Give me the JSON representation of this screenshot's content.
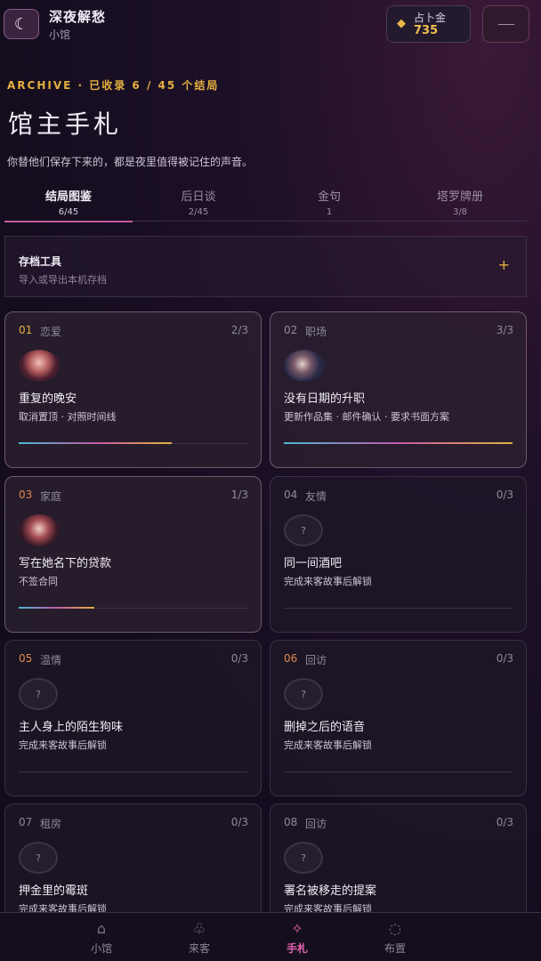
{
  "header": {
    "moon_icon": "moon-icon",
    "title": "深夜解愁",
    "subtitle": "小馆",
    "coin_label": "占卜金",
    "coin_value": "735",
    "menu_icon": "menu-icon"
  },
  "page": {
    "kicker": "ARCHIVE · 已收录 6 / 45 个结局",
    "title": "馆主手札",
    "description": "你替他们保存下来的，都是夜里值得被记住的声音。"
  },
  "tabs": [
    {
      "label": "结局图鉴",
      "count": "6/45",
      "active": true
    },
    {
      "label": "后日谈",
      "count": "2/45",
      "active": false
    },
    {
      "label": "金句",
      "count": "1",
      "active": false
    },
    {
      "label": "塔罗牌册",
      "count": "3/8",
      "active": false
    }
  ],
  "tools": {
    "title": "存档工具",
    "subtitle": "导入或导出本机存档",
    "expand_icon": "plus-icon"
  },
  "cards": [
    {
      "num": "01",
      "category": "恋爱",
      "count": "2/3",
      "title": "重复的晚安",
      "subtitle": "取消置顶 · 对照时间线",
      "unlocked": true,
      "progress": 0.67
    },
    {
      "num": "02",
      "category": "职场",
      "count": "3/3",
      "title": "没有日期的升职",
      "subtitle": "更新作品集 · 邮件确认 · 要求书面方案",
      "unlocked": true,
      "progress": 1.0
    },
    {
      "num": "03",
      "category": "家庭",
      "count": "1/3",
      "title": "写在她名下的贷款",
      "subtitle": "不签合同",
      "unlocked": true,
      "progress": 0.33
    },
    {
      "num": "04",
      "category": "友情",
      "count": "0/3",
      "title": "同一间酒吧",
      "subtitle": "完成来客故事后解锁",
      "unlocked": false,
      "progress": 0
    },
    {
      "num": "05",
      "category": "温情",
      "count": "0/3",
      "title": "主人身上的陌生狗味",
      "subtitle": "完成来客故事后解锁",
      "unlocked": false,
      "progress": 0
    },
    {
      "num": "06",
      "category": "回访",
      "count": "0/3",
      "title": "删掉之后的语音",
      "subtitle": "完成来客故事后解锁",
      "unlocked": false,
      "progress": 0
    },
    {
      "num": "07",
      "category": "租房",
      "count": "0/3",
      "title": "押金里的霉斑",
      "subtitle": "完成来客故事后解锁",
      "unlocked": false,
      "progress": 0
    },
    {
      "num": "08",
      "category": "回访",
      "count": "0/3",
      "title": "署名被移走的提案",
      "subtitle": "完成来客故事后解锁",
      "unlocked": false,
      "progress": 0
    }
  ],
  "locked_symbol": "?",
  "nav": [
    {
      "label": "小馆",
      "icon": "home-icon",
      "active": false
    },
    {
      "label": "来客",
      "icon": "guests-icon",
      "active": false
    },
    {
      "label": "手札",
      "icon": "sparkle-icon",
      "active": true
    },
    {
      "label": "布置",
      "icon": "settings-icon",
      "active": false
    }
  ],
  "colors": {
    "accent_gold": "#e6b040",
    "accent_pink": "#c25aa0",
    "nav_active": "#e060b0",
    "background": "#140d1e"
  }
}
